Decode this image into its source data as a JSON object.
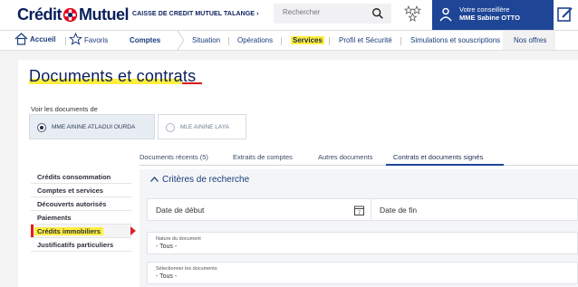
{
  "header": {
    "logo_text_left": "Crédit",
    "logo_text_right": "Mutuel",
    "caisse_link": "CAISSE DE CREDIT MUTUEL TALANGE ›",
    "search_placeholder": "Rechercher",
    "advisor_title": "Votre conseillère",
    "advisor_name": "MME Sabine OTTO"
  },
  "nav": {
    "home": "Accueil",
    "favorites": "Favoris",
    "comptes": "Comptes",
    "situation": "Situation",
    "operations": "Opérations",
    "services": "Services",
    "profil": "Profil et Sécurité",
    "simulations": "Simulations et souscriptions",
    "offres": "Nos offres"
  },
  "page": {
    "title": "Documents et contrats",
    "voir_label": "Voir les documents de",
    "holders": [
      {
        "label": "MME AININE ATLAOUI OURDA",
        "selected": true
      },
      {
        "label": "MLE AININE LAYA",
        "selected": false
      }
    ]
  },
  "tabs": [
    {
      "label": "Documents récents (5)"
    },
    {
      "label": "Extraits de comptes"
    },
    {
      "label": "Autres documents"
    },
    {
      "label": "Contrats et documents signés"
    }
  ],
  "sidemenu": [
    {
      "label": "Crédits consommation"
    },
    {
      "label": "Comptes et services"
    },
    {
      "label": "Découverts autorisés"
    },
    {
      "label": "Paiements"
    },
    {
      "label": "Crédits immobiliers"
    },
    {
      "label": "Justificatifs particuliers"
    }
  ],
  "criteria": {
    "title": "Critères de recherche",
    "date_start": "Date de début",
    "date_end": "Date de fin",
    "nature_label": "Nature du document",
    "nature_value": "- Tous -",
    "select_docs_label": "Sélectionner les documents",
    "select_docs_value": "- Tous -"
  },
  "colors": {
    "brand_navy": "#0a1f5c",
    "advisor_blue": "#1e4596",
    "highlight_yellow": "#ffee3d",
    "accent_red": "#d81b1b"
  }
}
